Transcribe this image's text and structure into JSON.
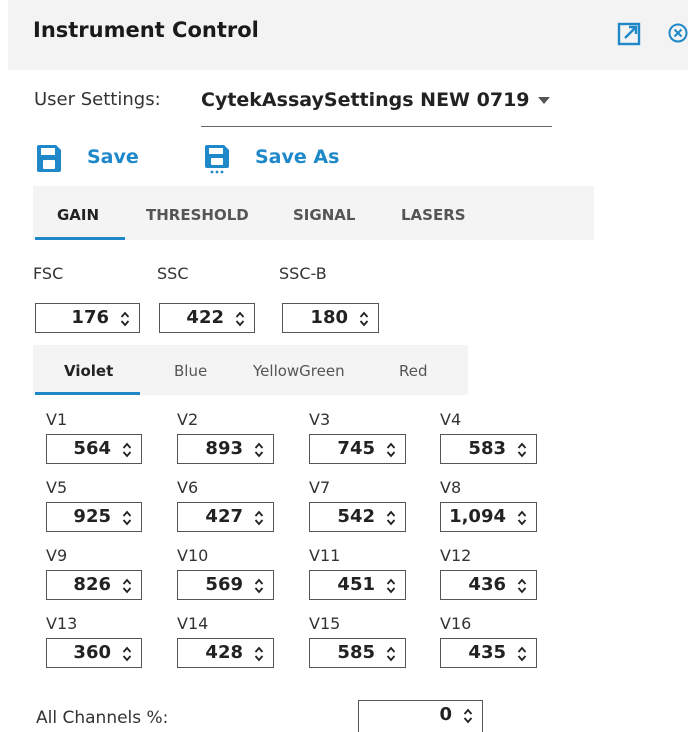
{
  "header": {
    "title": "Instrument Control"
  },
  "user_settings": {
    "label": "User Settings:",
    "value": "CytekAssaySettings NEW 0719 (A"
  },
  "actions": {
    "save": "Save",
    "save_as": "Save As"
  },
  "main_tabs": [
    "GAIN",
    "THRESHOLD",
    "SIGNAL",
    "LASERS"
  ],
  "scatter": [
    {
      "label": "FSC",
      "value": "176"
    },
    {
      "label": "SSC",
      "value": "422"
    },
    {
      "label": "SSC-B",
      "value": "180"
    }
  ],
  "sub_tabs": [
    "Violet",
    "Blue",
    "YellowGreen",
    "Red"
  ],
  "channels": [
    {
      "label": "V1",
      "value": "564"
    },
    {
      "label": "V2",
      "value": "893"
    },
    {
      "label": "V3",
      "value": "745"
    },
    {
      "label": "V4",
      "value": "583"
    },
    {
      "label": "V5",
      "value": "925"
    },
    {
      "label": "V6",
      "value": "427"
    },
    {
      "label": "V7",
      "value": "542"
    },
    {
      "label": "V8",
      "value": "1,094"
    },
    {
      "label": "V9",
      "value": "826"
    },
    {
      "label": "V10",
      "value": "569"
    },
    {
      "label": "V11",
      "value": "451"
    },
    {
      "label": "V12",
      "value": "436"
    },
    {
      "label": "V13",
      "value": "360"
    },
    {
      "label": "V14",
      "value": "428"
    },
    {
      "label": "V15",
      "value": "585"
    },
    {
      "label": "V16",
      "value": "435"
    }
  ],
  "all_channels": {
    "label": "All Channels %:",
    "value": "0"
  },
  "colors": {
    "accent": "#1e88c8"
  }
}
